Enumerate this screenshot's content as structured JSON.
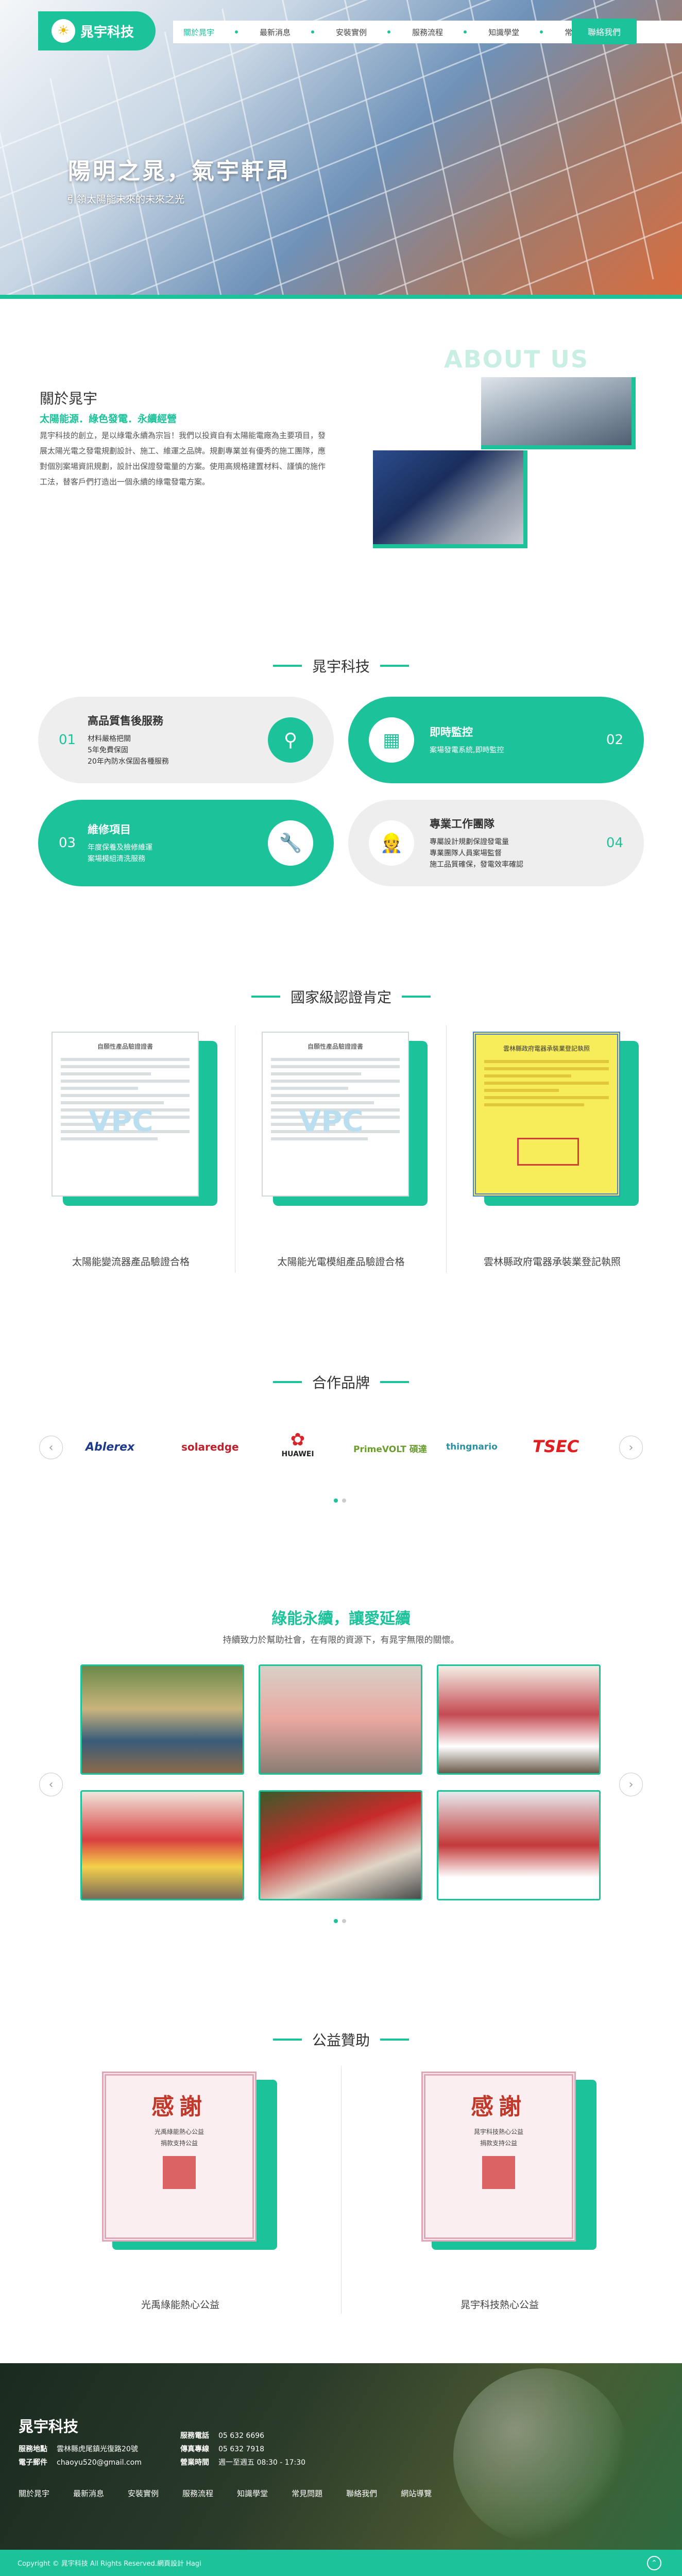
{
  "header": {
    "logo_text": "晁宇科技",
    "nav": [
      "關於晁宇",
      "最新消息",
      "安裝實例",
      "服務流程",
      "知識學堂",
      "常見問題"
    ],
    "contact_label": "聯絡我們"
  },
  "hero": {
    "title": "陽明之晁，氣宇軒昂",
    "subtitle": "引領太陽能未來的未來之光"
  },
  "about": {
    "title": "關於晁宇",
    "slogan": "太陽能源．綠色發電．永續經營",
    "text": "晁宇科技的創立，是以綠電永續為宗旨！我們以投資自有太陽能電廠為主要項目，發展太陽光電之發電規劃設計、施工、維運之品牌。規劃專業並有優秀的施工團隊，應對個別案場資訊規劃，設計出保證發電量的方案。使用高規格建置材料、謹慎的施作工法，替客戶們打造出一個永續的綠電發電方案。",
    "en_title": "ABOUT US"
  },
  "services": {
    "heading": "晁宇科技",
    "items": [
      {
        "num": "01",
        "title": "高品質售後服務",
        "lines": [
          "材料嚴格把關",
          "5年免費保固",
          "20年內防水保固各種服務"
        ]
      },
      {
        "num": "02",
        "title": "即時監控",
        "lines": [
          "案場發電系統,即時監控"
        ]
      },
      {
        "num": "03",
        "title": "維修項目",
        "lines": [
          "年度保養及檢修維運",
          "案場模組清洗服務"
        ]
      },
      {
        "num": "04",
        "title": "專業工作團隊",
        "lines": [
          "專屬設計規劃保證發電量",
          "專業團隊人員案場監督",
          "施工品質確保，發電效率確認"
        ]
      }
    ]
  },
  "certs": {
    "heading": "國家級認證肯定",
    "items": [
      {
        "doc_title": "自願性產品驗證證書",
        "caption": "太陽能變流器產品驗證合格"
      },
      {
        "doc_title": "自願性產品驗證證書",
        "caption": "太陽能光電模組產品驗證合格"
      },
      {
        "doc_title": "雲林縣政府電器承裝業登記執照",
        "caption": "雲林縣政府電器承裝業登記執照"
      }
    ]
  },
  "brands": {
    "heading": "合作品牌",
    "items": [
      "Ablerex",
      "solaredge",
      "HUAWEI",
      "PrimeVOLT 碩達",
      "thingnario",
      "TSEC"
    ]
  },
  "charity": {
    "title": "綠能永續，讓愛延續",
    "subtitle": "持續致力於幫助社會，在有限的資源下，有晁宇無限的關懷。"
  },
  "sponsor": {
    "heading": "公益贊助",
    "items": [
      {
        "doc_big": "感謝",
        "doc_lines": [
          "光禹綠能熱心公益",
          "捐款支持公益"
        ],
        "caption": "光禹綠能熱心公益"
      },
      {
        "doc_big": "感謝",
        "doc_lines": [
          "晁宇科技熱心公益",
          "捐款支持公益"
        ],
        "caption": "晁宇科技熱心公益"
      }
    ]
  },
  "footer": {
    "name": "晁宇科技",
    "address_label": "服務地點",
    "address": "雲林縣虎尾鎮光復路20號",
    "email_label": "電子郵件",
    "email": "chaoyu520@gmail.com",
    "phone_label": "服務電話",
    "phone": "05 632 6696",
    "fax_label": "傳真專線",
    "fax": "05 632 7918",
    "hours_label": "營業時間",
    "hours": "週一至週五 08:30 - 17:30",
    "links": [
      "關於晁宇",
      "最新消息",
      "安裝實例",
      "服務流程",
      "知識學堂",
      "常見問題",
      "聯絡我們",
      "網站導覽"
    ],
    "copyright": "Copyright © 晁宇科技 All Rights Reserved.網頁設計 Hagi"
  }
}
